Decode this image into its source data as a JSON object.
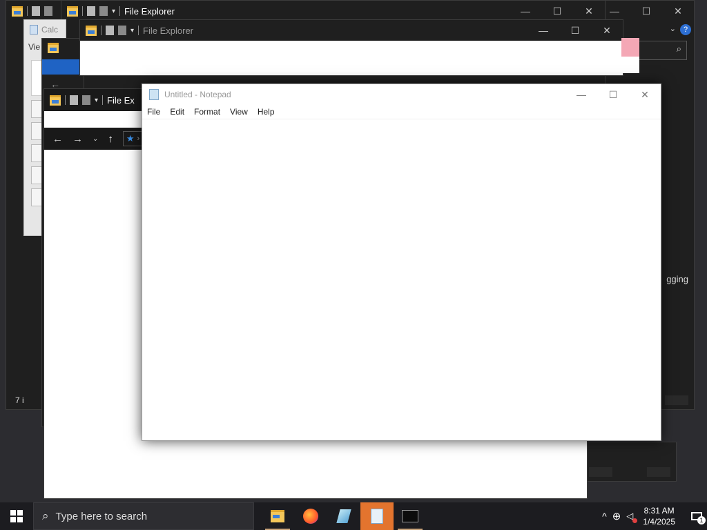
{
  "windows": {
    "explorer_back": {
      "title": "File Explorer"
    },
    "explorer_mid": {
      "title": "File Explorer",
      "status_count": "7 i"
    },
    "explorer_front": {
      "title": "File Ex",
      "status_count": "7 i"
    },
    "calculator": {
      "title": "Calc",
      "menu": "Vie"
    },
    "partial_text": "gging"
  },
  "notepad": {
    "title": "Untitled - Notepad",
    "menu": [
      "File",
      "Edit",
      "Format",
      "View",
      "Help"
    ]
  },
  "taskbar": {
    "search_placeholder": "Type here to search",
    "apps": [
      "file-explorer",
      "firefox",
      "paint-3d",
      "notepad",
      "command-prompt"
    ],
    "time": "8:31 AM",
    "date": "1/4/2025",
    "notification_count": "1"
  },
  "colors": {
    "accent": "#e3742e",
    "titlebar": "#1f1f1f"
  }
}
